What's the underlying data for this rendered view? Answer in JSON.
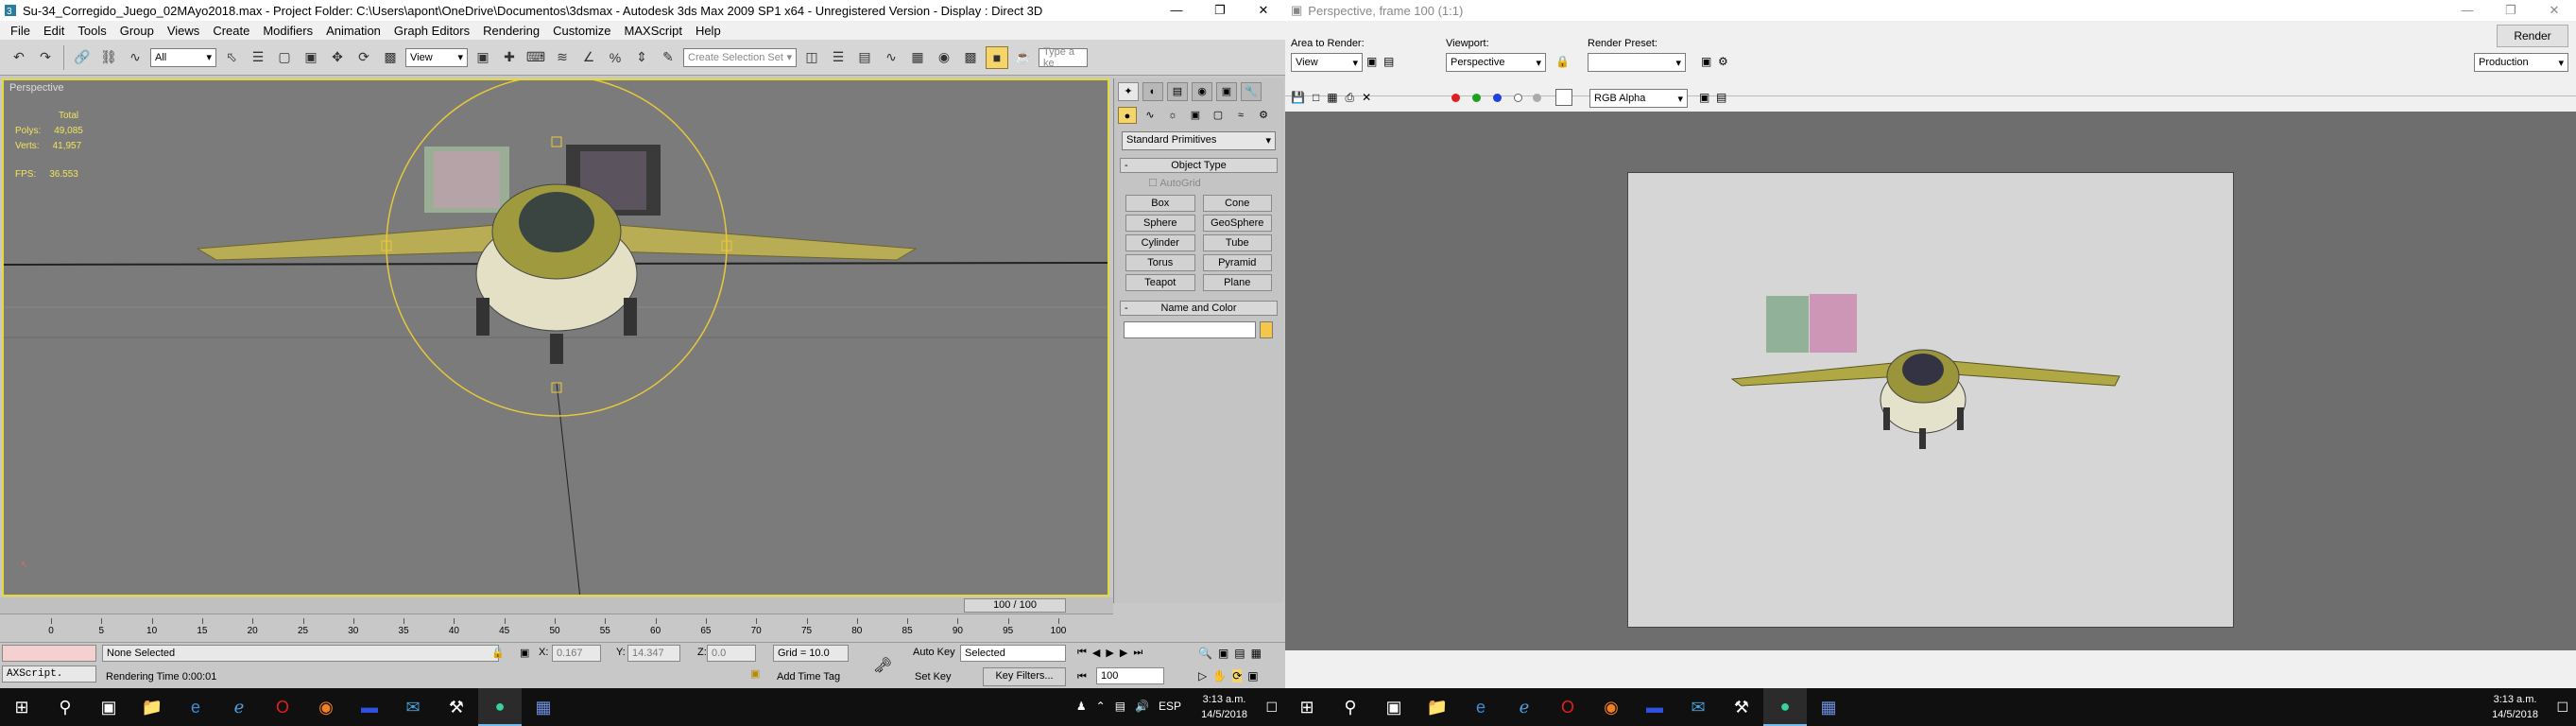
{
  "max": {
    "title": "Su-34_Corregido_Juego_02MAyo2018.max    - Project Folder: C:\\Users\\apont\\OneDrive\\Documentos\\3dsmax    - Autodesk 3ds Max  2009 SP1  x64    - Unregistered Version    - Display : Direct 3D",
    "menu": [
      "File",
      "Edit",
      "Tools",
      "Group",
      "Views",
      "Create",
      "Modifiers",
      "Animation",
      "Graph Editors",
      "Rendering",
      "Customize",
      "MAXScript",
      "Help"
    ],
    "toolbar": {
      "selection_filter": "All",
      "ref_coord": "View",
      "named_selection": "Create Selection Set",
      "search": "Type a ke"
    },
    "viewport": {
      "label": "Perspective",
      "stats": {
        "header": "Total",
        "polys_label": "Polys:",
        "polys": "49,085",
        "verts_label": "Verts:",
        "verts": "41,957",
        "fps_label": "FPS:",
        "fps": "36.553"
      }
    },
    "command_panel": {
      "category": "Standard Primitives",
      "object_type_title": "Object Type",
      "autogrid": "AutoGrid",
      "primitives": [
        "Box",
        "Cone",
        "Sphere",
        "GeoSphere",
        "Cylinder",
        "Tube",
        "Torus",
        "Pyramid",
        "Teapot",
        "Plane"
      ],
      "name_color_title": "Name and Color"
    },
    "time_slider": "100 / 100",
    "track_ticks": [
      "0",
      "5",
      "10",
      "15",
      "20",
      "25",
      "30",
      "35",
      "40",
      "45",
      "50",
      "55",
      "60",
      "65",
      "70",
      "75",
      "80",
      "85",
      "90",
      "95",
      "100"
    ],
    "status": {
      "maxscript": "AXScript.",
      "selection": "None Selected",
      "render_time": "Rendering Time  0:00:01",
      "x_label": "X:",
      "x": "0.167",
      "y_label": "Y:",
      "y": "14.347",
      "z_label": "Z:",
      "z": "0.0",
      "grid": "Grid = 10.0",
      "add_time_tag": "Add Time Tag",
      "auto_key": "Auto Key",
      "set_key": "Set Key",
      "key_mode": "Selected",
      "key_filters": "Key Filters...",
      "frame": "100"
    }
  },
  "taskbar_left": {
    "lang": "ESP",
    "time": "3:13 a.m.",
    "date": "14/5/2018"
  },
  "render_frame": {
    "title": "Perspective, frame 100 (1:1)",
    "area_label": "Area to Render:",
    "area_value": "View",
    "viewport_label": "Viewport:",
    "viewport_value": "Perspective",
    "preset_label": "Render Preset:",
    "preset_value": "",
    "render_button": "Render",
    "mode": "Production",
    "channel": "RGB Alpha",
    "colors": {
      "red": "#e02020",
      "green": "#20a020",
      "blue": "#2040e0"
    }
  },
  "taskbar_right": {
    "time": "3:13 a.m.",
    "date": "14/5/2018"
  }
}
